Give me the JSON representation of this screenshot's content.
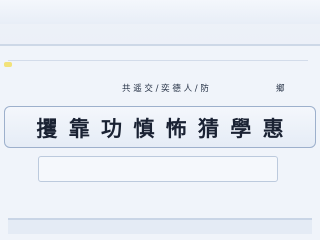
{
  "header": {
    "subtitle": "共 遥 交 / 奕 德 人 / 防",
    "corner_tag": "鄉"
  },
  "main": {
    "title": "攫 靠 功 慎 怖 猜 學 惠",
    "input_value": ""
  },
  "colors": {
    "background": "#e2e9f4",
    "border": "#9db0cc",
    "accent": "#f2e27a"
  }
}
